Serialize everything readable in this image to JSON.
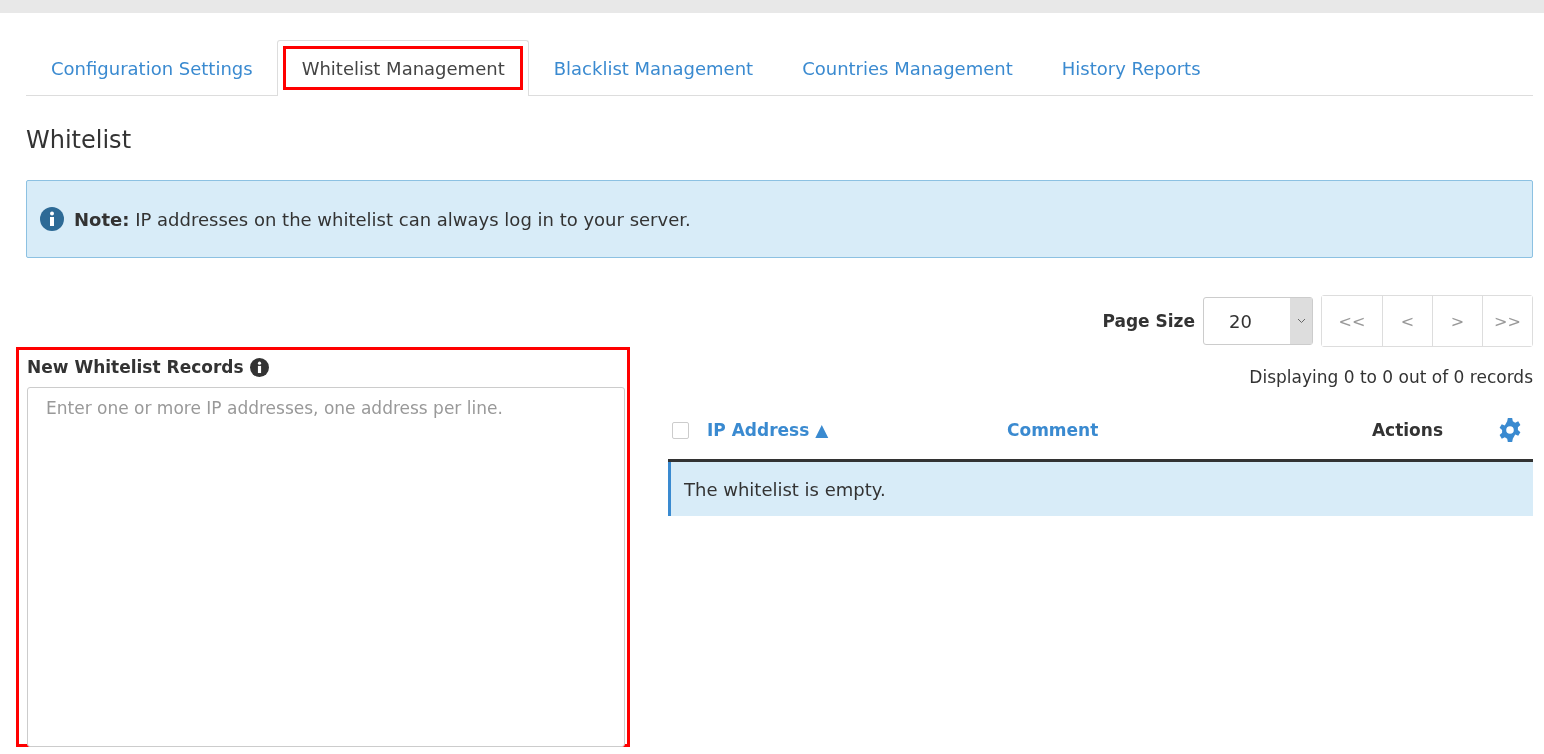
{
  "tabs": [
    {
      "label": "Configuration Settings",
      "selected": false,
      "highlighted": false
    },
    {
      "label": "Whitelist Management",
      "selected": true,
      "highlighted": true
    },
    {
      "label": "Blacklist Management",
      "selected": false,
      "highlighted": false
    },
    {
      "label": "Countries Management",
      "selected": false,
      "highlighted": false
    },
    {
      "label": "History Reports",
      "selected": false,
      "highlighted": false
    }
  ],
  "heading": "Whitelist",
  "note": "**Note:** IP addresses on the whitelist can always log in to your server.",
  "new_records": {
    "label": "New Whitelist Records",
    "placeholder": "Enter one or more IP addresses, one address per line.",
    "highlighted": true
  },
  "pagination": {
    "page_size_label": "Page Size",
    "page_size": "20",
    "buttons": [
      "<<",
      "<",
      ">",
      ">>"
    ],
    "summary": "Displaying 0 to 0 out of 0 records"
  },
  "table": {
    "select_all_checked": false,
    "columns": [
      {
        "label": "IP Address ▲",
        "sortable": true
      },
      {
        "label": "Comment",
        "sortable": true
      },
      {
        "label": "Actions",
        "sortable": false
      }
    ],
    "empty_message": "The whitelist is empty."
  }
}
